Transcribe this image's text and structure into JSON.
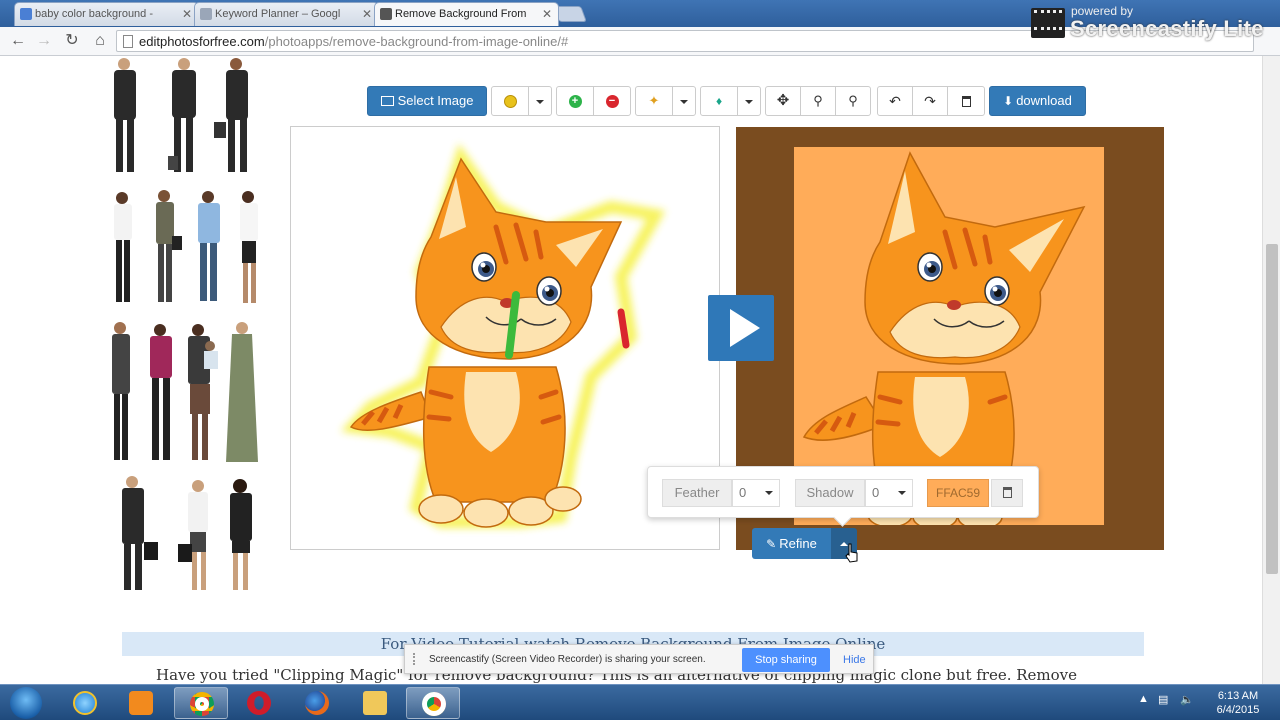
{
  "tabs": [
    {
      "title": "baby color background -",
      "favicon_color": "#4a7fd4"
    },
    {
      "title": "Keyword Planner – Googl",
      "favicon_color": "#9aa6b8"
    },
    {
      "title": "Remove Background From",
      "favicon_color": "#555555"
    }
  ],
  "address": {
    "domain": "editphotosforfree.com",
    "path": "/photoapps/remove-background-from-image-online/#"
  },
  "screencastify": {
    "powered_by": "powered by",
    "brand": "Screencastify Lite"
  },
  "toolbar": {
    "select_image": "Select Image",
    "download": "download"
  },
  "refine_popover": {
    "feather_label": "Feather",
    "feather_value": "0",
    "shadow_label": "Shadow",
    "shadow_value": "0",
    "color_value": "FFAC59"
  },
  "refine_button": "Refine",
  "banner_text": "For Video Tutorial watch Remove Background From Image Online",
  "paragraph": "Have you tried \"Clipping Magic\" for remove background? This is an alternative of clipping magic clone but free. Remove",
  "share_bar": {
    "message": "Screencastify (Screen Video Recorder) is sharing your screen.",
    "stop": "Stop sharing",
    "hide": "Hide"
  },
  "clock": {
    "time": "6:13 AM",
    "date": "6/4/2015"
  },
  "colors": {
    "primary": "#337ab7",
    "selected_bg": "#ffac59",
    "frame_bg": "#7a4c1f"
  }
}
